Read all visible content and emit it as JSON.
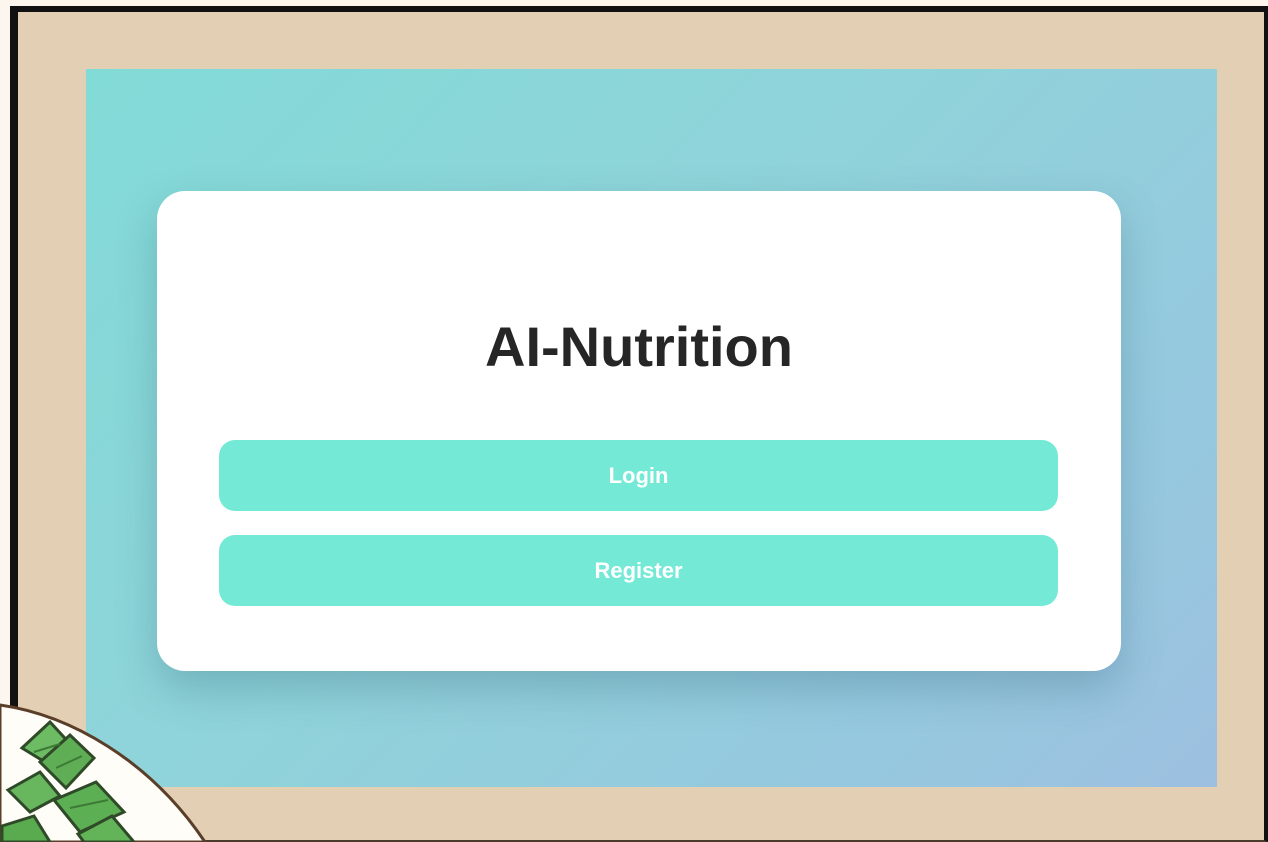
{
  "app": {
    "title": "AI-Nutrition"
  },
  "actions": {
    "login_label": "Login",
    "register_label": "Register"
  },
  "colors": {
    "button": "#74ead6",
    "button_text": "#ffffff",
    "title_text": "#262626",
    "card": "#ffffff",
    "frame": "#e2cfb4",
    "screen_gradient_start": "#82dbd7",
    "screen_gradient_end": "#9dc0e0"
  },
  "decor": {
    "corner_plant_icon": "leaf-plant-icon"
  }
}
